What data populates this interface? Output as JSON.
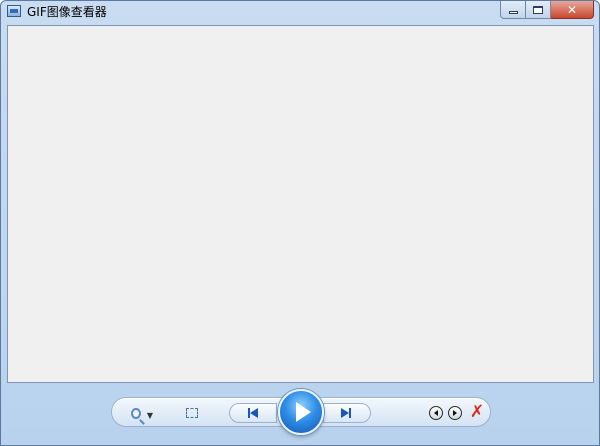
{
  "window": {
    "title": "GIF图像查看器",
    "icon": "app-image-icon"
  },
  "caption_buttons": {
    "minimize_icon": "minimize-icon",
    "maximize_icon": "maximize-icon",
    "close_label": "✕"
  },
  "toolbar": {
    "zoom_icon": "zoom-in-icon",
    "fit_icon": "actual-size-icon",
    "prev_icon": "previous-icon",
    "play_icon": "play-icon",
    "next_icon": "next-icon",
    "rotate_left_icon": "rotate-left-icon",
    "rotate_right_icon": "rotate-right-icon",
    "delete_label": "✗"
  },
  "colors": {
    "frame": "#b8d2ee",
    "viewer_bg": "#f0f0f0",
    "play_blue": "#2f8ee6",
    "close_red": "#c9472f",
    "delete_red": "#d42b1a"
  }
}
